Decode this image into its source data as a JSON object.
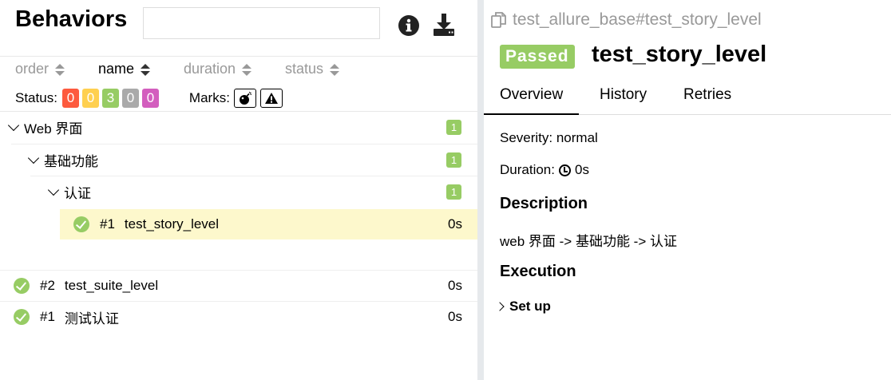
{
  "header": {
    "title": "Behaviors",
    "search_placeholder": ""
  },
  "sort": [
    {
      "label": "order"
    },
    {
      "label": "name"
    },
    {
      "label": "duration"
    },
    {
      "label": "status"
    }
  ],
  "filter": {
    "status_label": "Status:",
    "counts": [
      {
        "value": "0",
        "color": "#fd5a3e"
      },
      {
        "value": "0",
        "color": "#ffd050"
      },
      {
        "value": "3",
        "color": "#97cc64"
      },
      {
        "value": "0",
        "color": "#aaaaaa"
      },
      {
        "value": "0",
        "color": "#d35ebe"
      }
    ],
    "marks_label": "Marks:"
  },
  "tree": {
    "group1": {
      "label": "Web 界面",
      "count": "1"
    },
    "group2": {
      "label": "基础功能",
      "count": "1"
    },
    "group3": {
      "label": "认证",
      "count": "1"
    },
    "selected_test": {
      "num": "#1",
      "name": "test_story_level",
      "duration": "0s"
    },
    "tests": [
      {
        "num": "#2",
        "name": "test_suite_level",
        "duration": "0s"
      },
      {
        "num": "#1",
        "name": "测试认证",
        "duration": "0s"
      }
    ]
  },
  "detail": {
    "breadcrumb": "test_allure_base#test_story_level",
    "status": "Passed",
    "title": "test_story_level",
    "tabs": [
      "Overview",
      "History",
      "Retries"
    ],
    "severity": "Severity: normal",
    "duration_label": "Duration:",
    "duration_value": "0s",
    "description_heading": "Description",
    "description": "web 界面 -> 基础功能 -> 认证",
    "execution_heading": "Execution",
    "setup_label": "Set up"
  },
  "colors": {
    "passed": "#97cc64",
    "selected_row": "#fdf8cc"
  }
}
